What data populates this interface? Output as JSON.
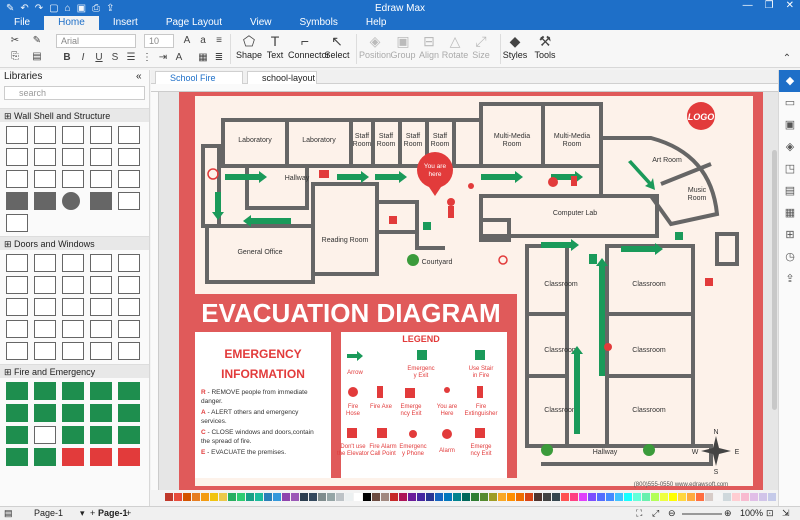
{
  "app": {
    "title": "Edraw Max"
  },
  "menu": {
    "items": [
      "File",
      "Home",
      "Insert",
      "Page Layout",
      "View",
      "Symbols",
      "Help"
    ],
    "active": "Home"
  },
  "ribbon": {
    "font_name": "Arial",
    "font_size": "10",
    "buttons": {
      "shape": "Shape",
      "text": "Text",
      "connector": "Connector",
      "select": "Select",
      "position": "Position",
      "group": "Group",
      "align": "Align",
      "rotate": "Rotate",
      "size": "Size",
      "styles": "Styles",
      "tools": "Tools"
    }
  },
  "libraries": {
    "title": "Libraries",
    "search_placeholder": "search",
    "sections": [
      "Wall Shell and Structure",
      "Doors and Windows",
      "Fire and Emergency"
    ]
  },
  "tabs": [
    "School Fire Evacua...",
    "school-layout"
  ],
  "diagram": {
    "rooms": {
      "lab1": "Laboratory",
      "lab2": "Laboratory",
      "staff1": "Staff",
      "staff2": "Staff",
      "staff3": "Staff",
      "staff4": "Staff",
      "room_word": "Room",
      "mm1a": "Multi-Media",
      "mm1b": "Room",
      "mm2a": "Multi-Media",
      "mm2b": "Room",
      "art": "Art Room",
      "music1": "Music",
      "music2": "Room",
      "hallway1": "Hallway",
      "hallway2": "Hallway",
      "computer": "Computer Lab",
      "reading": "Reading Room",
      "general": "General Office",
      "courtyard": "Courtyard",
      "class1": "Classroom",
      "class2": "Classroom",
      "class3": "Classroom",
      "class4": "Classroom",
      "class5": "Classroom",
      "class6": "Classroom"
    },
    "you_are_here_1": "You are",
    "you_are_here_2": "here",
    "logo": "LOGO",
    "heading": "EVACUATION  DIAGRAM",
    "emergency_title_1": "EMERGENCY",
    "emergency_title_2": "INFORMATION",
    "steps": [
      {
        "key": "R",
        "text1": " - REMOVE people from immediate",
        "text2": "danger."
      },
      {
        "key": "A",
        "text1": " - ALERT others and emergency",
        "text2": "services."
      },
      {
        "key": "C",
        "text1": " - CLOSE windows and doors,contain",
        "text2": "the spread of fire."
      },
      {
        "key": "E",
        "text1": " - EVACUATE the premises.",
        "text2": ""
      }
    ],
    "legend_title": "LEGEND",
    "legend": {
      "arrow": "Arrow",
      "emerg_exit_1": "Emergenc",
      "emerg_exit_2": "y Exit",
      "stair_1": "Use Stair",
      "stair_2": "in Fire",
      "hose_1": "Fire",
      "hose_2": "Hose",
      "axe": "Fire Axe",
      "exit2_1": "Emerge",
      "exit2_2": "ncy Exit",
      "here_1": "You are",
      "here_2": "Here",
      "ext_1": "Fire",
      "ext_2": "Extinguisher",
      "elev_1": "Don't use",
      "elev_2": "the Elevator",
      "alarm_cp_1": "Fire Alarm",
      "alarm_cp_2": "Call Point",
      "phone_1": "Emergenc",
      "phone_2": "y Phone",
      "alarm": "Alarm",
      "exit3_1": "Emerge",
      "exit3_2": "ncy Exit"
    },
    "compass": {
      "n": "N",
      "s": "S",
      "e": "E",
      "w": "W"
    },
    "footer": "(800)555-0550 www.edrawsoft.com"
  },
  "status": {
    "page_selector": "Page-1",
    "page_tab": "Page-1",
    "zoom": "100%"
  },
  "palette": [
    "#c0392b",
    "#e74c3c",
    "#d35400",
    "#e67e22",
    "#f39c12",
    "#f1c40f",
    "#ecc94b",
    "#27ae60",
    "#2ecc71",
    "#16a085",
    "#1abc9c",
    "#2980b9",
    "#3498db",
    "#8e44ad",
    "#9b59b6",
    "#2c3e50",
    "#34495e",
    "#7f8c8d",
    "#95a5a6",
    "#bdc3c7",
    "#ecf0f1",
    "#ffffff",
    "#000000",
    "#6d4c41",
    "#a1887f",
    "#c62828",
    "#ad1457",
    "#6a1b9a",
    "#4527a0",
    "#283593",
    "#1565c0",
    "#0277bd",
    "#00838f",
    "#00695c",
    "#2e7d32",
    "#558b2f",
    "#9e9d24",
    "#f9a825",
    "#ff8f00",
    "#ef6c00",
    "#d84315",
    "#4e342e",
    "#424242",
    "#37474f",
    "#ff5252",
    "#ff4081",
    "#e040fb",
    "#7c4dff",
    "#536dfe",
    "#448aff",
    "#40c4ff",
    "#18ffff",
    "#64ffda",
    "#69f0ae",
    "#b2ff59",
    "#eeff41",
    "#ffff00",
    "#ffd740",
    "#ffab40",
    "#ff6e40",
    "#d7ccc8",
    "#f5f5f5",
    "#cfd8dc",
    "#ffcdd2",
    "#f8bbd0",
    "#e1bee7",
    "#d1c4e9",
    "#c5cae9"
  ]
}
